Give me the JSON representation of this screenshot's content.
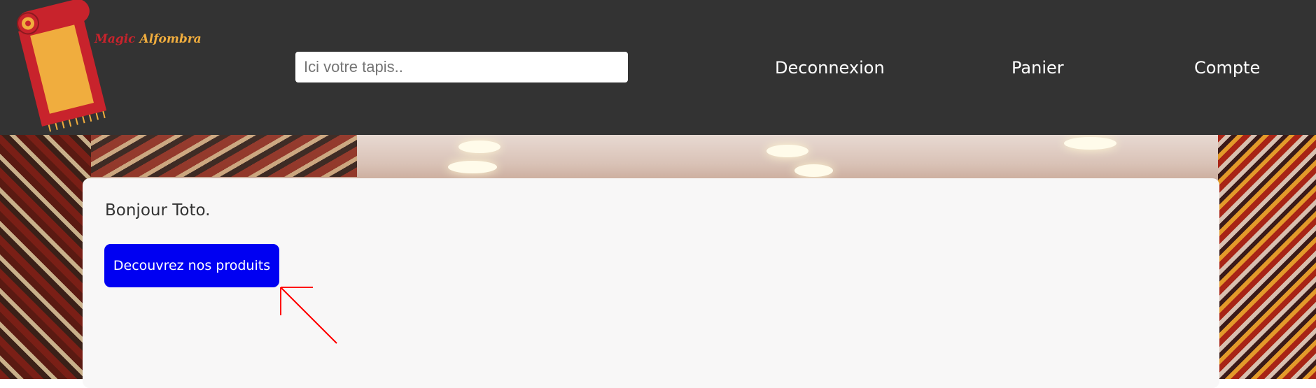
{
  "header": {
    "logo": {
      "word1": "Magic",
      "word2": "Alfombra",
      "icon": "rug-logo-icon"
    },
    "search": {
      "placeholder": "Ici votre tapis..",
      "value": ""
    },
    "nav": [
      {
        "label": "Deconnexion"
      },
      {
        "label": "Panier"
      },
      {
        "label": "Compte"
      }
    ]
  },
  "main": {
    "greeting": "Bonjour Toto.",
    "cta_label": "Decouvrez nos produits",
    "annotation_icon": "red-arrow-icon"
  },
  "colors": {
    "header_bg": "#333333",
    "card_bg": "#f8f7f7",
    "cta_bg": "#0000f2",
    "logo_red": "#c8232c",
    "logo_orange": "#f0ad3e",
    "arrow": "#ff0000"
  }
}
